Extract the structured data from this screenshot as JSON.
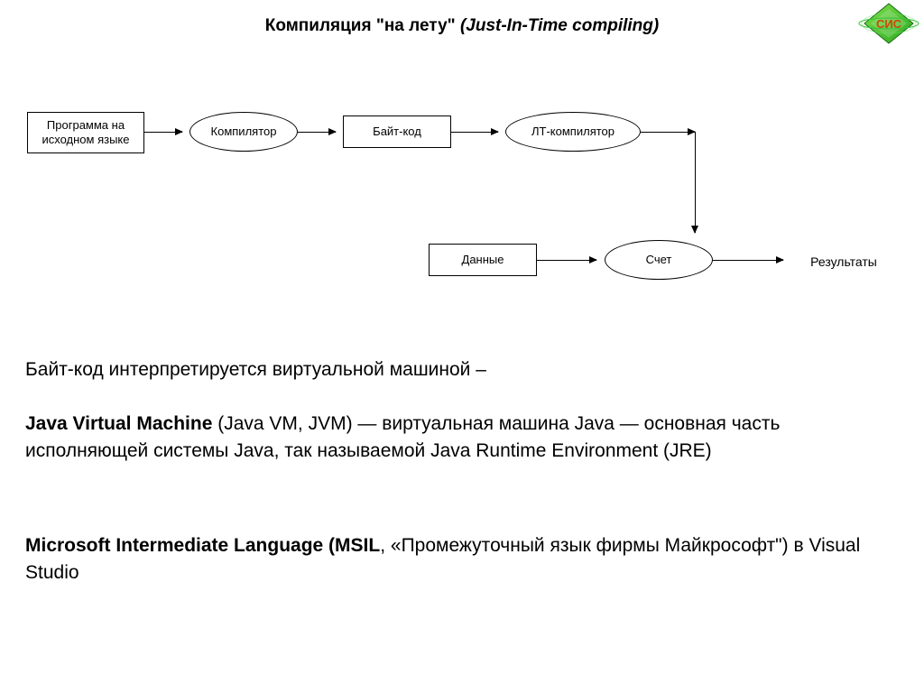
{
  "title": {
    "ru": "Компиляция \"на лету\"",
    "en": "(Just-In-Time compiling)"
  },
  "logo_text": "СИС",
  "diagram": {
    "nodes": {
      "source": "Программа на исходном языке",
      "compiler": "Компилятор",
      "bytecode": "Байт-код",
      "jit": "ЛТ-компилятор",
      "data": "Данные",
      "run": "Счет",
      "results": "Результаты"
    }
  },
  "para1": "Байт-код интерпретируется виртуальной машиной –",
  "para2_pre_bold": "Java Virtual Machine",
  "para2_rest": " (Java VM, JVM) — виртуальная машина Java — основная часть исполняющей системы Java, так называемой Java Runtime Environment (JRE)",
  "para3_pre_bold": "Microsoft Intermediate Language (MSIL",
  "para3_rest": ", «Промежуточный язык фирмы Майкрософт\") в Visual Studio"
}
